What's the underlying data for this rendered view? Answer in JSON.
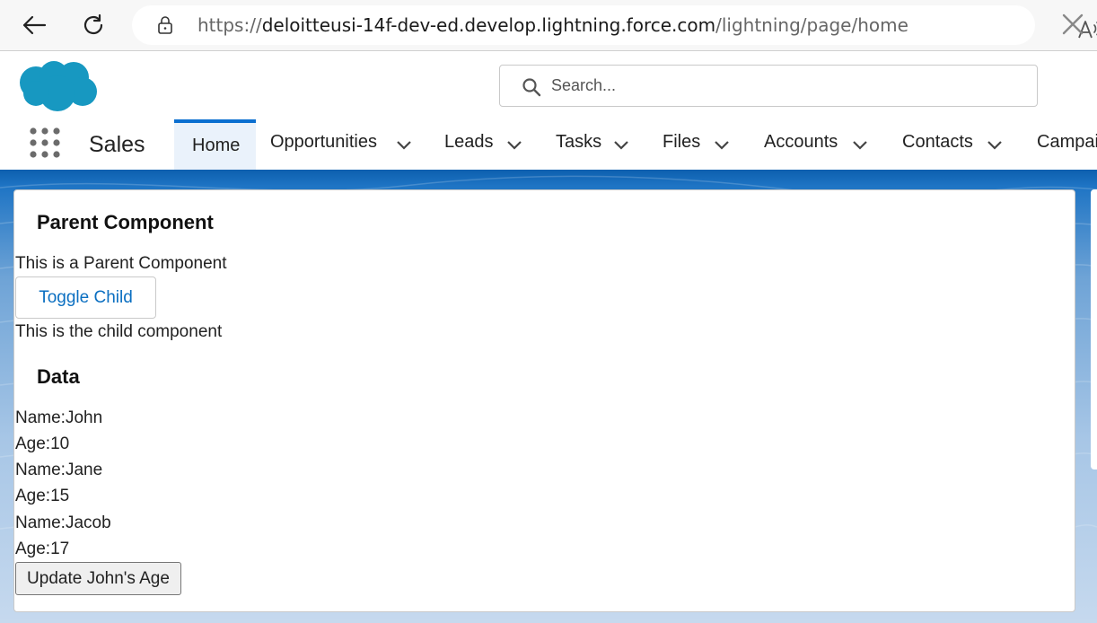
{
  "browser": {
    "url_prefix": "https://",
    "url_host": "deloitteusi-14f-dev-ed.develop.lightning.force.com",
    "url_path": "/lightning/page/home"
  },
  "header": {
    "search_placeholder": "Search...",
    "app_name": "Sales",
    "tabs": [
      {
        "label": "Home",
        "active": true
      },
      {
        "label": "Opportunities"
      },
      {
        "label": "Leads"
      },
      {
        "label": "Tasks"
      },
      {
        "label": "Files"
      },
      {
        "label": "Accounts"
      },
      {
        "label": "Contacts"
      },
      {
        "label": "Campaigns"
      }
    ]
  },
  "parent": {
    "title": "Parent Component",
    "description": "This is a Parent Component",
    "toggle_label": "Toggle Child",
    "child_text": "This is the child component"
  },
  "data_section": {
    "title": "Data",
    "lines": [
      "Name:John",
      "Age:10",
      "Name:Jane",
      "Age:15",
      "Name:Jacob",
      "Age:17"
    ],
    "update_label": "Update John's Age"
  },
  "colors": {
    "brand_blue": "#0b6fd0",
    "link_blue": "#0b6fc1",
    "salesforce_cloud": "#1798c1"
  }
}
